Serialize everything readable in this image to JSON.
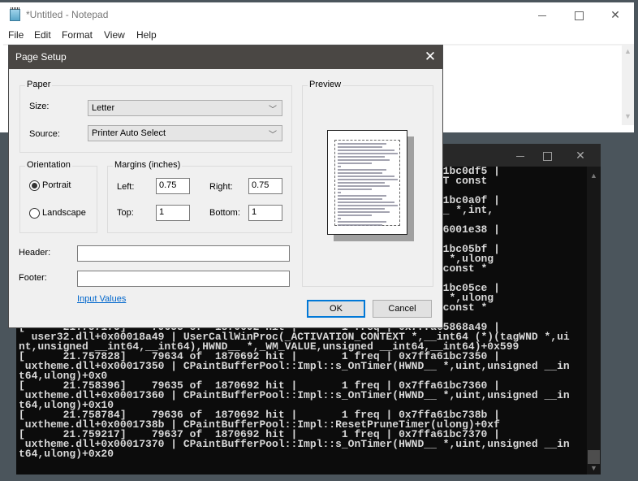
{
  "notepad": {
    "title": "*Untitled - Notepad",
    "menu": [
      "File",
      "Edit",
      "Format",
      "View",
      "Help"
    ],
    "icons": {
      "minimize": "minimize-icon",
      "maximize": "maximize-icon",
      "close": "close-icon",
      "app": "notepad-icon"
    }
  },
  "console": {
    "lines": [
      "[      21.75????]    ?9??? of  1870692 hit |       1 freq | 0x7ffa61bc0df5 |",
      "  ???????????????????????????????????????????????????onst &,tagPOINT const",
      "",
      "[      21.75????]    ?9??? of  1870692 hit |       1 freq | 0x7ffa61bc0a0f |",
      "  ???????????????????????????????????????????????????j const *,HDC__ *,int,",
      "",
      "[      21.75????]    ?9??? of  1870692 hit |       1 freq | 0x7ffa66001e38 |",
      "",
      "[      21.75????]    ?9??? of  1870692 hit |       1 freq | 0x7ffa61bc05bf |",
      "  ???????????????????????????????????????????????????.tagRECT const *,ulong",
      "  ???????????????????????????????????????????????????const,tagRECT const *",
      "",
      "[      21.75????]    ?9??? of  1870692 hit |       1 freq | 0x7ffa61bc05ce |",
      "  ???????????????????????????????????????????????????.tagRECT const *,ulong",
      "  ???????????????????????????????????????????????????const,tagRECT const *",
      "",
      "[      21.757175]    79633 of  1870692 hit |       1 freq | 0x7ffa65868a49 |",
      "  user32.dll+0x00018a49 | UserCallWinProc(_ACTIVATION_CONTEXT *,__int64 (*)(tagWND *,ui",
      "nt,unsigned __int64,__int64),HWND__ *,_WM_VALUE,unsigned __int64,__int64)+0x599",
      "[      21.757828]    79634 of  1870692 hit |       1 freq | 0x7ffa61bc7350 |",
      " uxtheme.dll+0x00017350 | CPaintBufferPool::Impl::s_OnTimer(HWND__ *,uint,unsigned __in",
      "t64,ulong)+0x0",
      "[      21.758396]    79635 of  1870692 hit |       1 freq | 0x7ffa61bc7360 |",
      " uxtheme.dll+0x00017360 | CPaintBufferPool::Impl::s_OnTimer(HWND__ *,uint,unsigned __in",
      "t64,ulong)+0x10",
      "[      21.758784]    79636 of  1870692 hit |       1 freq | 0x7ffa61bc738b |",
      " uxtheme.dll+0x0001738b | CPaintBufferPool::Impl::ResetPruneTimer(ulong)+0xf",
      "[      21.759217]    79637 of  1870692 hit |       1 freq | 0x7ffa61bc7370 |",
      " uxtheme.dll+0x00017370 | CPaintBufferPool::Impl::s_OnTimer(HWND__ *,uint,unsigned __in",
      "t64,ulong)+0x20"
    ],
    "scroll_position_fraction": 0.97
  },
  "dialog": {
    "title": "Page Setup",
    "paper": {
      "legend": "Paper",
      "size_label": "Size:",
      "size_value": "Letter",
      "source_label": "Source:",
      "source_value": "Printer Auto Select"
    },
    "orientation": {
      "legend": "Orientation",
      "portrait_label": "Portrait",
      "landscape_label": "Landscape",
      "selected": "Portrait"
    },
    "margins": {
      "legend": "Margins (inches)",
      "left_label": "Left:",
      "left_value": "0.75",
      "right_label": "Right:",
      "right_value": "0.75",
      "top_label": "Top:",
      "top_value": "1",
      "bottom_label": "Bottom:",
      "bottom_value": "1"
    },
    "preview": {
      "legend": "Preview"
    },
    "header_label": "Header:",
    "header_value": "",
    "footer_label": "Footer:",
    "footer_value": "",
    "link_label": "Input Values",
    "ok_label": "OK",
    "cancel_label": "Cancel"
  }
}
